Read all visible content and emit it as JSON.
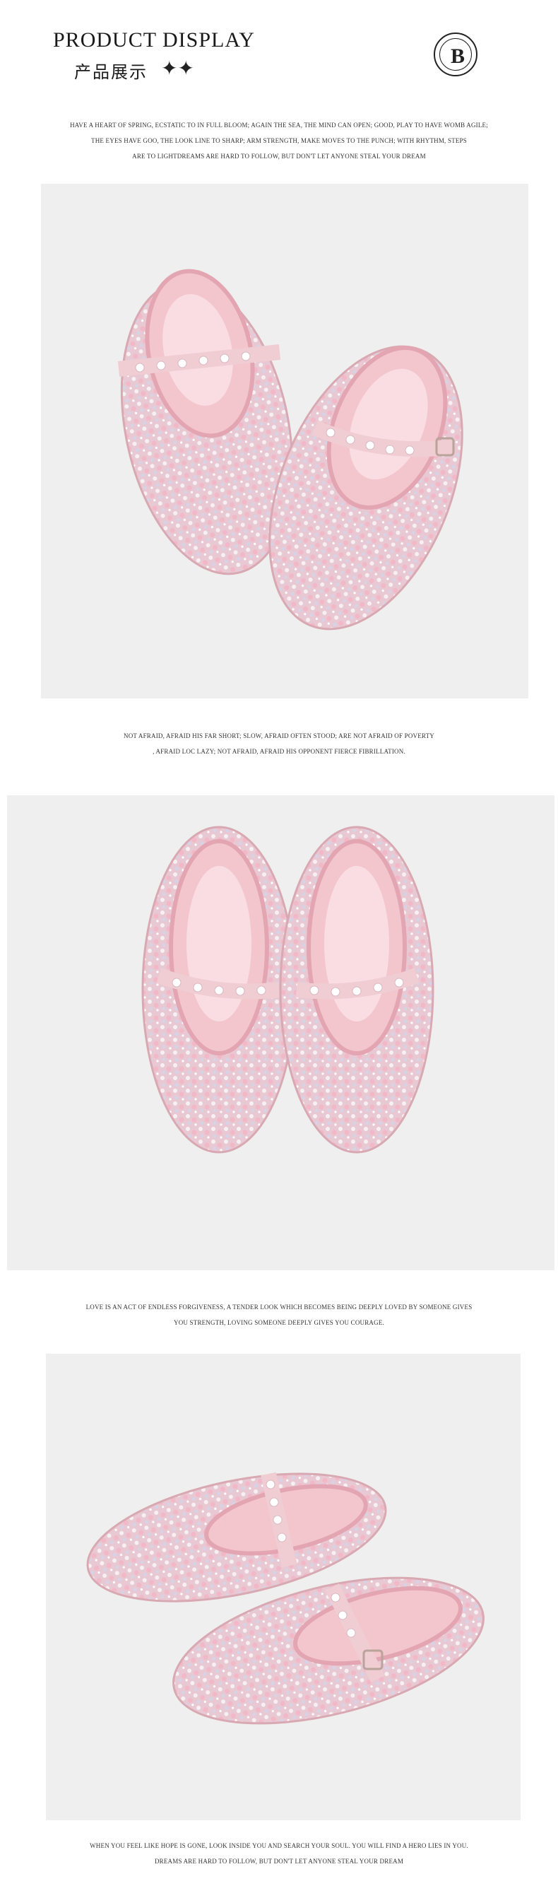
{
  "header": {
    "title_en": "PRODUCT DISPLAY",
    "title_cn": "产品展示",
    "sparkle": "✦✦",
    "logo_letter": "B"
  },
  "text1": [
    "HAVE A HEART OF SPRING, ECSTATIC TO IN FULL BLOOM; AGAIN THE SEA, THE MIND CAN OPEN; GOOD, PLAY TO HAVE WOMB AGILE;",
    "THE EYES HAVE GOO, THE LOOK LINE TO SHARP; ARM STRENGTH, MAKE MOVES TO THE PUNCH; WITH RHYTHM, STEPS",
    "ARE TO LIGHTDREAMS ARE HARD TO FOLLOW, BUT DON'T LET ANYONE STEAL YOUR DREAM"
  ],
  "text2": [
    "NOT AFRAID, AFRAID HIS FAR SHORT; SLOW, AFRAID OFTEN STOOD; ARE NOT AFRAID OF POVERTY",
    ", AFRAID LOC LAZY; NOT AFRAID, AFRAID HIS OPPONENT FIERCE FIBRILLATION."
  ],
  "text3": [
    "LOVE IS AN ACT OF ENDLESS FORGIVENESS, A TENDER LOOK WHICH BECOMES BEING DEEPLY LOVED BY SOMEONE GIVES",
    "YOU STRENGTH, LOVING SOMEONE DEEPLY GIVES YOU COURAGE."
  ],
  "text4": [
    "WHEN YOU FEEL LIKE HOPE IS GONE, LOOK INSIDE YOU AND SEARCH YOUR SOUL. YOU WILL FIND A HERO LIES IN YOU.",
    "DREAMS ARE HARD TO FOLLOW, BUT DON'T LET ANYONE STEAL YOUR DREAM"
  ],
  "colors": {
    "photo_bg": "#efefef",
    "shoe_pink": "#e9b8c0",
    "shoe_lining": "#f2c6cc",
    "sparkle": "#f7f0f3"
  }
}
